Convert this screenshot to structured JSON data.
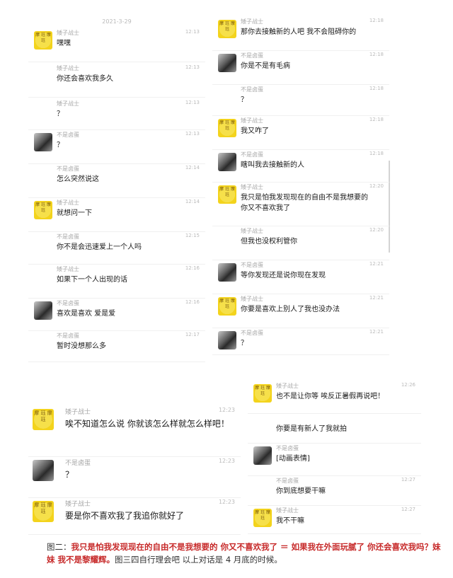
{
  "p1": {
    "date": "2021-3-29",
    "messages": [
      {
        "name": "矮子战士",
        "time": "12:13",
        "text": "嘿嘿",
        "avatar": "yellow"
      },
      {
        "name": "矮子战士",
        "time": "12:13",
        "text": "你还会喜欢我多久",
        "avatar": ""
      },
      {
        "name": "矮子战士",
        "time": "12:13",
        "text": "？",
        "avatar": ""
      },
      {
        "name": "不是卤蛋",
        "time": "12:13",
        "text": "？",
        "avatar": "photo"
      },
      {
        "name": "不是卤蛋",
        "time": "12:14",
        "text": "怎么突然说这",
        "avatar": ""
      },
      {
        "name": "矮子战士",
        "time": "12:14",
        "text": "就想问一下",
        "avatar": "yellow"
      },
      {
        "name": "不是卤蛋",
        "time": "12:15",
        "text": "你不是会迅速爱上一个人吗",
        "avatar": ""
      },
      {
        "name": "矮子战士",
        "time": "12:16",
        "text": "如果下一个人出现的话",
        "avatar": ""
      },
      {
        "name": "不是卤蛋",
        "time": "12:16",
        "text": "喜欢是喜欢 爱是爱",
        "avatar": "photo"
      },
      {
        "name": "不是卤蛋",
        "time": "12:17",
        "text": "暂时没想那么多",
        "avatar": ""
      }
    ]
  },
  "p2": {
    "messages": [
      {
        "name": "矮子战士",
        "time": "12:18",
        "text": "那你去接触新的人吧 我不会阻碍你的",
        "avatar": "yellow"
      },
      {
        "name": "不是卤蛋",
        "time": "12:18",
        "text": "你是不是有毛病",
        "avatar": "photo"
      },
      {
        "name": "不是卤蛋",
        "time": "12:18",
        "text": "？",
        "avatar": ""
      },
      {
        "name": "矮子战士",
        "time": "12:18",
        "text": "我又咋了",
        "avatar": "yellow"
      },
      {
        "name": "不是卤蛋",
        "time": "12:18",
        "text": "瞎叫我去接触新的人",
        "avatar": "photo"
      },
      {
        "name": "矮子战士",
        "time": "12:20",
        "text": "我只是怕我发现现在的自由不是我想要的\n你又不喜欢我了",
        "avatar": "yellow"
      },
      {
        "name": "矮子战士",
        "time": "12:20",
        "text": "但我也没权利管你",
        "avatar": ""
      },
      {
        "name": "不是卤蛋",
        "time": "12:21",
        "text": "等你发现还是说你现在发现",
        "avatar": "photo"
      },
      {
        "name": "矮子战士",
        "time": "12:21",
        "text": "你要是喜欢上别人了我也没办法",
        "avatar": "yellow"
      },
      {
        "name": "不是卤蛋",
        "time": "12:21",
        "text": "？",
        "avatar": "photo"
      }
    ]
  },
  "p3": {
    "messages": [
      {
        "name": "矮子战士",
        "time": "12:23",
        "text": "唉不知道怎么说 你就该怎么样就怎么样吧！",
        "avatar": "yellow"
      },
      {
        "name": "不是卤蛋",
        "time": "12:23",
        "text": "？",
        "avatar": "photo"
      },
      {
        "name": "矮子战士",
        "time": "12:23",
        "text": "要是你不喜欢我了我追你就好了",
        "avatar": "yellow"
      }
    ]
  },
  "p4": {
    "messages": [
      {
        "name": "矮子战士",
        "time": "12:26",
        "text": "也不是让你等 唉反正暑假再说吧！",
        "avatar": "yellow"
      },
      {
        "name": "",
        "time": "",
        "text": "你要是有新人了我就拍",
        "avatar": ""
      },
      {
        "name": "不是卤蛋",
        "time": "",
        "text": "[动画表情]",
        "avatar": "photo"
      },
      {
        "name": "不是卤蛋",
        "time": "12:27",
        "text": "你到底想要干嘛",
        "avatar": ""
      },
      {
        "name": "矮子战士",
        "time": "12:27",
        "text": "我不干嘛",
        "avatar": "yellow"
      }
    ]
  },
  "caption": {
    "prefix": "图二：",
    "red1": "我只是怕我发现现在的自由不是我想要的 你又不喜欢我了 ＝ 如果我在外面玩腻了 你还会喜欢我吗？妹妹 我不是黎耀辉。",
    "rest": "图三四自行理会吧 以上对话是 4 月底的时候。"
  }
}
